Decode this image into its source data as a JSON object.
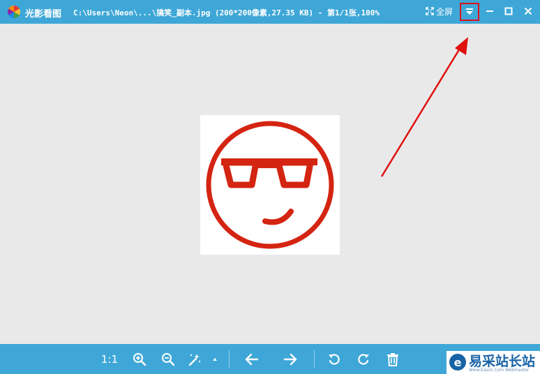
{
  "titlebar": {
    "app_name": "光影看图",
    "file_info": "C:\\Users\\Neon\\...\\搞笑_副本.jpg (200*200像素,27.35 KB) - 第1/1张,100%",
    "fullscreen_label": "全屏"
  },
  "toolbar": {
    "actual_size_label": "1:1"
  },
  "watermark": {
    "name": "易采站长站",
    "url": "Www.Easck.Com  Webmaster"
  },
  "colors": {
    "titlebar": "#3ea7d7",
    "canvas": "#e9e9e9",
    "highlight": "#d8131e",
    "emoji": "#d42412"
  },
  "icons": [
    "app-logo",
    "fullscreen-icon",
    "dropdown-menu-icon",
    "minimize-icon",
    "maximize-icon",
    "close-icon",
    "zoom-in-icon",
    "zoom-out-icon",
    "magic-wand-icon",
    "previous-arrow-icon",
    "next-arrow-icon",
    "rotate-left-icon",
    "rotate-right-icon",
    "trash-icon"
  ]
}
